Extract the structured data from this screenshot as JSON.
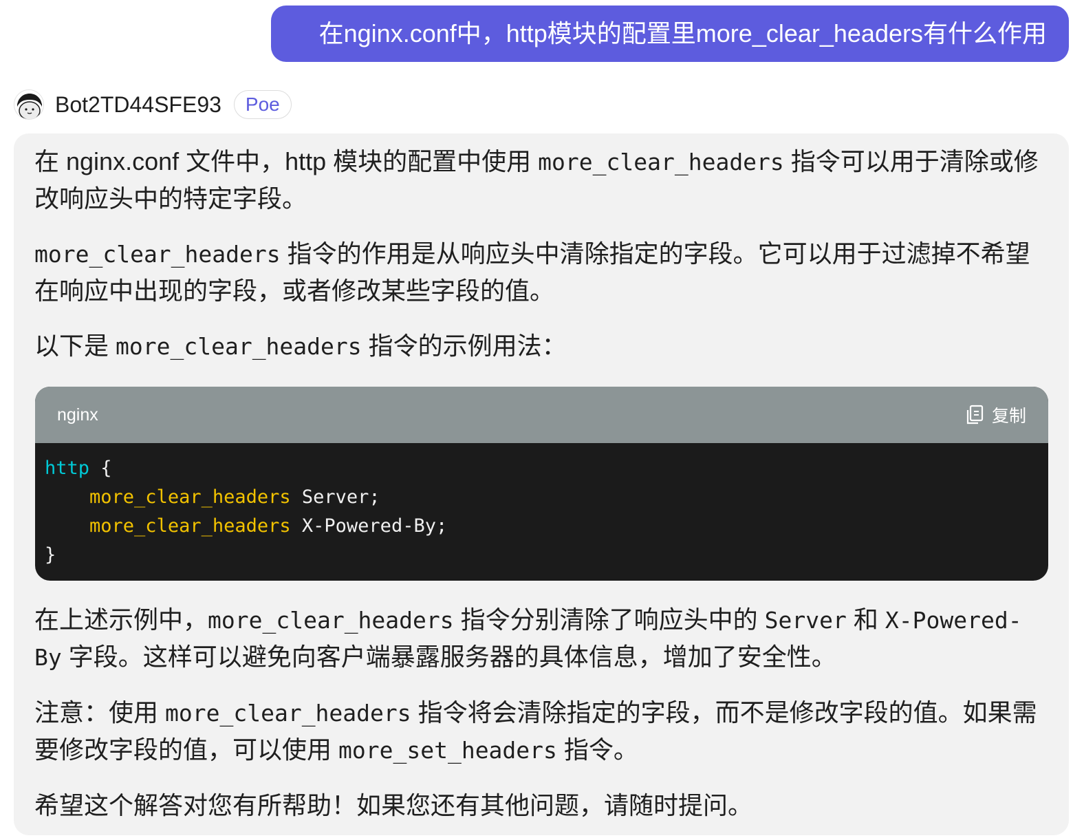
{
  "user_message": {
    "text": "在nginx.conf中，http模块的配置里more_clear_headers有什么作用"
  },
  "bot": {
    "name": "Bot2TD44SFE93",
    "badge": "Poe",
    "avatar_icon": "cartoon-face-avatar-icon"
  },
  "response": {
    "p1": {
      "a": "在 nginx.conf 文件中，http 模块的配置中使用 ",
      "code": "more_clear_headers",
      "b": " 指令可以用于清除或修改响应头中的特定字段。"
    },
    "p2": {
      "code": "more_clear_headers",
      "a": " 指令的作用是从响应头中清除指定的字段。它可以用于过滤掉不希望在响应中出现的字段，或者修改某些字段的值。"
    },
    "p3": {
      "a": "以下是 ",
      "code": "more_clear_headers",
      "b": " 指令的示例用法："
    },
    "code_block": {
      "language": "nginx",
      "copy_label": "复制",
      "copy_icon": "copy-icon",
      "lines": [
        {
          "kw": "http",
          "rest": " {"
        },
        {
          "indent": "    ",
          "dir": "more_clear_headers",
          "rest": " Server;"
        },
        {
          "indent": "    ",
          "dir": "more_clear_headers",
          "rest": " X-Powered-By;"
        },
        {
          "rest": "}"
        }
      ]
    },
    "p4": {
      "a": "在上述示例中，",
      "code1": "more_clear_headers",
      "b": " 指令分别清除了响应头中的 ",
      "code2": "Server",
      "c": " 和 ",
      "code3": "X-Powered-By",
      "d": " 字段。这样可以避免向客户端暴露服务器的具体信息，增加了安全性。"
    },
    "p5": {
      "a": "注意：使用 ",
      "code1": "more_clear_headers",
      "b": " 指令将会清除指定的字段，而不是修改字段的值。如果需要修改字段的值，可以使用 ",
      "code2": "more_set_headers",
      "c": " 指令。"
    },
    "p6": {
      "a": "希望这个解答对您有所帮助！如果您还有其他问题，请随时提问。"
    }
  },
  "colors": {
    "user_bubble": "#5d5cde",
    "bot_bubble": "#f2f2f2",
    "code_header": "#8c9596",
    "code_bg": "#1b1b1b",
    "keyword": "#00c9d6",
    "directive": "#f2c200"
  }
}
